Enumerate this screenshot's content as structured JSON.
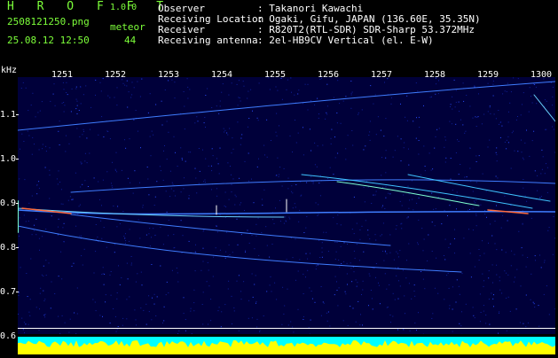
{
  "app": {
    "name": "H R O F F T",
    "version": "1.0.0"
  },
  "file": {
    "name": "2508121250.png",
    "datetime": "25.08.12 12:50"
  },
  "counter": {
    "label": "meteor",
    "value": "44"
  },
  "info": [
    {
      "key": "Observer",
      "value": ": Takanori Kawachi"
    },
    {
      "key": "Receiving Location",
      "value": ": Ogaki, Gifu, JAPAN (136.60E, 35.35N)"
    },
    {
      "key": "Receiver",
      "value": ": R820T2(RTL-SDR) SDR-Sharp 53.372MHz"
    },
    {
      "key": "Receiving antenna",
      "value": ": 2el-HB9CV Vertical (el. E-W)"
    }
  ],
  "axes": {
    "y_unit": "kHz",
    "y_ticks": [
      "1.1",
      "1.0",
      "0.9",
      "0.8",
      "0.7",
      "0.6"
    ],
    "x_ticks": [
      "1251",
      "1252",
      "1253",
      "1254",
      "1255",
      "1256",
      "1257",
      "1258",
      "1259",
      "1300"
    ]
  },
  "colors": {
    "accent": "#7dff3a",
    "background": "#000000",
    "plot_bg": "#00003a",
    "signal": "#3f7dff",
    "spectrum_bar": "#ffff00",
    "spectrum_base": "#00ffff"
  }
}
